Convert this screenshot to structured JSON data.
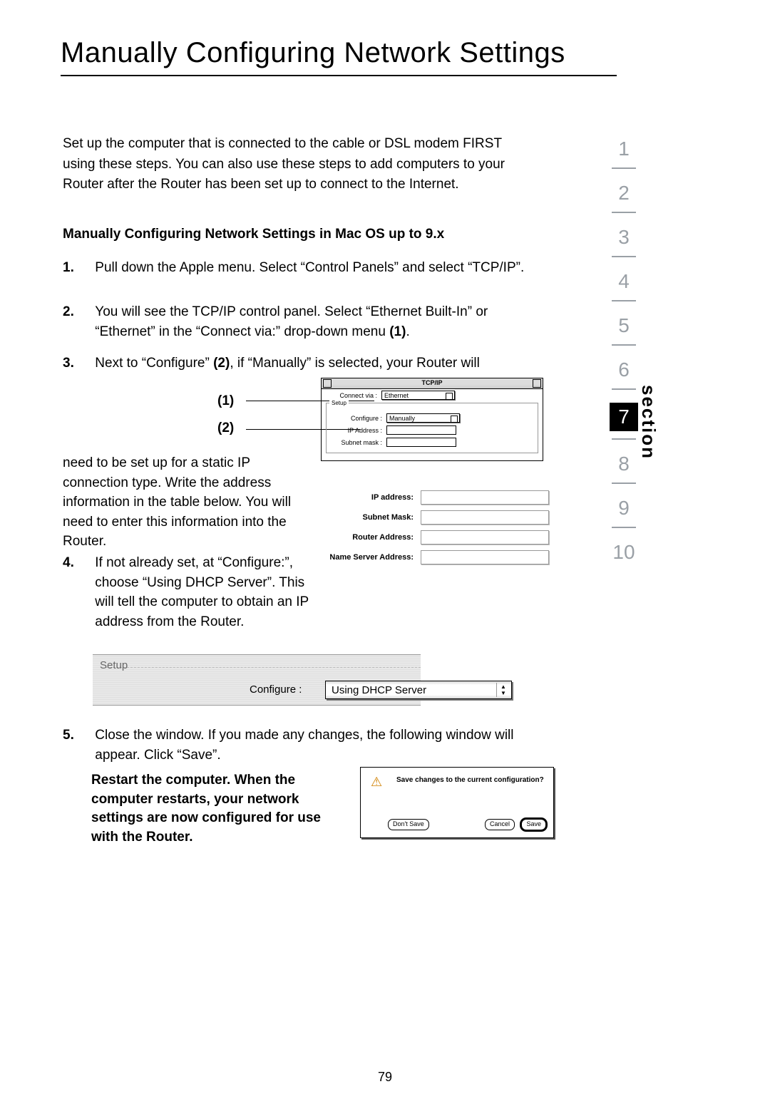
{
  "page_number": "79",
  "title": "Manually Configuring Network Settings",
  "side_label": "section",
  "side_numbers": [
    "1",
    "2",
    "3",
    "4",
    "5",
    "6",
    "7",
    "8",
    "9",
    "10"
  ],
  "side_active": "7",
  "intro": "Set up the computer that is connected to the cable or DSL modem FIRST using these steps. You can also use these steps to add computers to your Router after the Router has been set up to connect to the Internet.",
  "subhead": "Manually Configuring Network Settings in Mac OS up to 9.x",
  "steps": {
    "s1": {
      "n": "1.",
      "t": "Pull down the Apple menu. Select “Control Panels” and select “TCP/IP”."
    },
    "s2": {
      "n": "2.",
      "t_a": "You will see the TCP/IP control panel. Select “Ethernet Built-In” or “Ethernet” in the “Connect via:” drop-down menu ",
      "t_b": "(1)",
      "t_c": "."
    },
    "s3": {
      "n": "3.",
      "t_a": "Next to “Configure” ",
      "t_b": "(2)",
      "t_c": ", if “Manually” is selected, your Router will"
    },
    "s3_cont": "need to be set up for a static IP connection type. Write the address information in the table below. You will need to enter this information into the Router.",
    "s4": {
      "n": "4.",
      "t": "If not already set, at “Configure:”, choose “Using DHCP Server”. This will tell the computer to obtain an IP address from the Router."
    },
    "s5": {
      "n": "5.",
      "t": "Close the window. If you made any changes, the following window will appear. Click “Save”."
    }
  },
  "callout1": "(1)",
  "callout2": "(2)",
  "tcpip": {
    "title": "TCP/IP",
    "region": "Setup",
    "connect_via_label": "Connect via :",
    "connect_via_value": "Ethernet",
    "configure_label": "Configure :",
    "configure_value": "Manually",
    "ip_label": "IP Address :",
    "subnet_label": "Subnet mask :"
  },
  "addr_table": {
    "ip": "IP address:",
    "subnet": "Subnet Mask:",
    "router": "Router Address:",
    "ns": "Name Server Address:"
  },
  "dhcp": {
    "region": "Setup",
    "label": "Configure :",
    "value": "Using DHCP Server"
  },
  "restart_note": "Restart the computer. When the computer restarts, your network settings are now configured for use with the Router.",
  "dialog": {
    "msg": "Save changes to the current configuration?",
    "dont_save": "Don't Save",
    "cancel": "Cancel",
    "save": "Save"
  }
}
